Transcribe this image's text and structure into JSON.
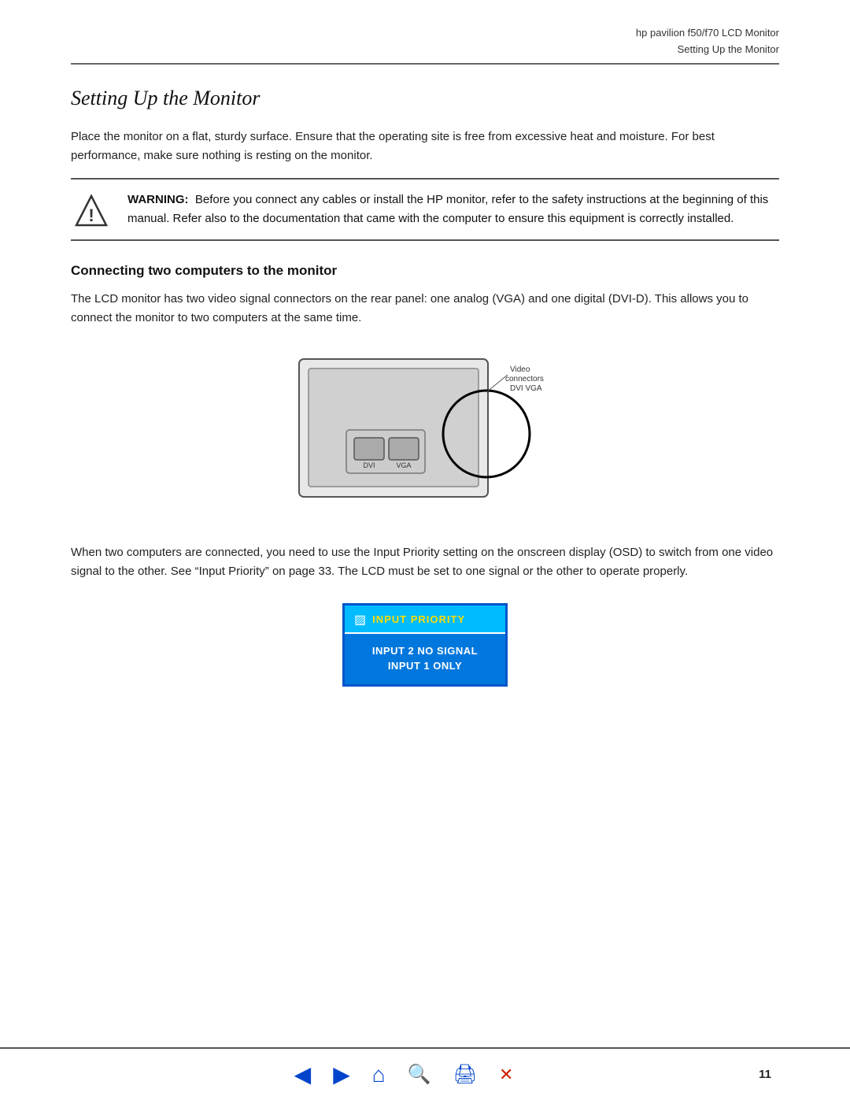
{
  "header": {
    "product": "hp pavilion f50/f70 LCD Monitor",
    "chapter": "Setting Up the Monitor"
  },
  "section": {
    "title": "Setting Up the Monitor",
    "intro": "Place the monitor on a flat, sturdy surface. Ensure that the operating site is free from excessive heat and moisture. For best performance, make sure nothing is resting on the monitor.",
    "warning_label": "WARNING:",
    "warning_text": "Before you connect any cables or install the HP monitor, refer to the safety instructions at the beginning of this manual. Refer also to the documentation that came with the computer to ensure this equipment is correctly installed.",
    "subsection_title": "Connecting two computers to the monitor",
    "subsection_text1": "The LCD monitor has two video signal connectors on the rear panel: one analog (VGA) and one digital (DVI-D). This allows you to connect the monitor to two computers at the same time.",
    "diagram_label_connectors": "Video connectors",
    "diagram_label_dvi": "DVI",
    "diagram_label_vga": "VGA",
    "subsection_text2": "When two computers are connected, you need to use the Input Priority setting on the onscreen display (OSD) to switch from one video signal to the other. See “Input Priority” on page 33. The LCD must be set to one signal or the other to operate properly.",
    "osd_title": "INPUT PRIORITY",
    "osd_line1": "INPUT 2 NO SIGNAL",
    "osd_line2": "INPUT 1 ONLY"
  },
  "footer": {
    "page_number": "11",
    "icons": [
      {
        "name": "arrow-left",
        "symbol": "◄"
      },
      {
        "name": "arrow-right",
        "symbol": "►"
      },
      {
        "name": "home",
        "symbol": "⌂"
      },
      {
        "name": "search",
        "symbol": "🔍"
      },
      {
        "name": "print",
        "symbol": "🖨"
      },
      {
        "name": "close",
        "symbol": "✕"
      }
    ]
  }
}
